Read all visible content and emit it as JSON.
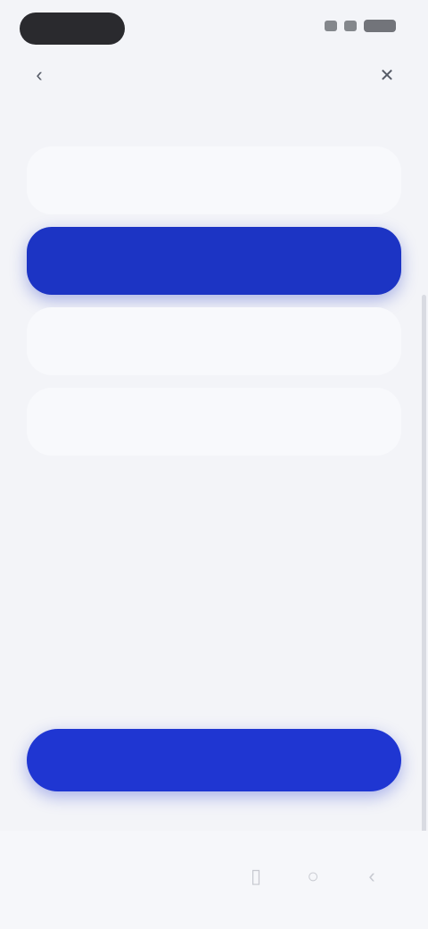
{
  "header": {
    "title": "",
    "back_icon": "chevron-left-icon",
    "close_icon": "close-icon"
  },
  "options": [
    {
      "label": "",
      "selected": false
    },
    {
      "label": "",
      "selected": true
    },
    {
      "label": "",
      "selected": false
    },
    {
      "label": "",
      "selected": false
    }
  ],
  "disclaimer": {
    "text": "",
    "link_text": ""
  },
  "primary_button": {
    "label": ""
  },
  "colors": {
    "accent": "#1f36d2",
    "background": "#f3f4f8",
    "option_bg": "#f8f9fc"
  },
  "nav_bar": {
    "icons": [
      "recents-icon",
      "home-icon",
      "back-icon"
    ]
  }
}
